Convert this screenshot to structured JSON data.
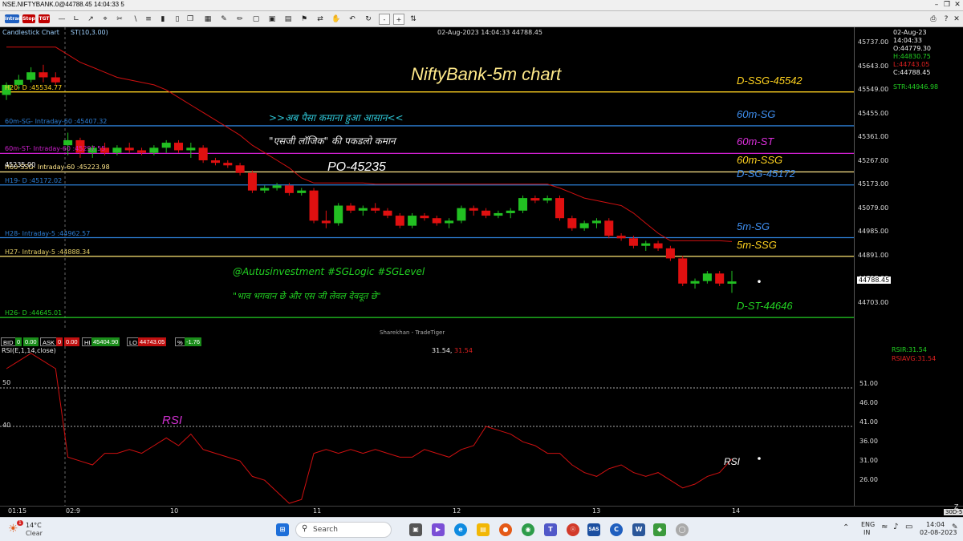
{
  "window": {
    "title": "NSE.NIFTYBANK.0@44788.45 14:04:33 5"
  },
  "toolbar": {
    "intraday_label": "Intraday",
    "stop_label": "Stop",
    "tgt_label": "TGT",
    "zoom_minus": "-",
    "zoom_plus": "+"
  },
  "chart": {
    "type_label": "Candlestick Chart",
    "indicator_label": "ST(10,3.00)",
    "header_time": "02-Aug-2023 14:04:33 44788.45",
    "title_annotation": "NiftyBank-5m chart",
    "hindi_line1": ">>अब पैसा कमाना हुआ आसान<<",
    "hindi_line2": "\"एसजी लॉजिक\" की पकडलो कमान",
    "po_label": "PO-45235",
    "handle_line": "@Autusinvestment  #SGLogic  #SGLevel",
    "hindi_line3": "\"भाव भगवान छे और एस जी लेवल देवदूत छे\"",
    "watermark": "Sharekhan - TradeTiger",
    "levels": [
      {
        "left_label": "H20- D :45534.77",
        "right_label": "D-SSG-45542",
        "price": 45542,
        "color": "#ffd21f",
        "right_color": "#ffd21f"
      },
      {
        "left_label": "60m-SG- Intraday-60 :45407.32",
        "right_label": "60m-SG",
        "price": 45407.32,
        "color": "#2d7fd6",
        "right_color": "#3f8ff0"
      },
      {
        "left_label": "60m-ST- Intraday-60 :45297.55",
        "right_label": "60m-ST",
        "price": 45297.55,
        "color": "#d020d0",
        "right_color": "#e030e0"
      },
      {
        "left_label": "H60-SSG- Intraday-60 :45223.98",
        "right_label": "60m-SSG",
        "price": 45223.98,
        "color": "#ffe68a",
        "right_color": "#ffd21f"
      },
      {
        "left_label": "45235.00",
        "right_label": "",
        "price": 45235,
        "color": "#ffffff",
        "right_color": "#ffffff"
      },
      {
        "left_label": "H19- D :45172.02",
        "right_label": "D-SG-45172",
        "price": 45172.02,
        "color": "#2d7fd6",
        "right_color": "#3f8ff0"
      },
      {
        "left_label": "H28- Intraday-5 :44962.57",
        "right_label": "5m-SG",
        "price": 44962.57,
        "color": "#2d7fd6",
        "right_color": "#3f8ff0"
      },
      {
        "left_label": "H27- Intraday-5 :44888.34",
        "right_label": "5m-SSG",
        "price": 44888.34,
        "color": "#e8d36a",
        "right_color": "#ffd21f"
      },
      {
        "left_label": "H26- D :44645.01",
        "right_label": "D-ST-44646",
        "price": 44645.01,
        "color": "#22d022",
        "right_color": "#22d022"
      }
    ],
    "price_axis": [
      "45737.00",
      "45643.00",
      "45549.00",
      "45455.00",
      "45361.00",
      "45267.00",
      "45173.00",
      "45079.00",
      "44985.00",
      "44891.00",
      "44797.00",
      "44703.00"
    ],
    "current_price_tag": "44788.45",
    "ohlc_panel": {
      "date": "02-Aug-23",
      "time": "14:04:33",
      "open": "O:44779.30",
      "high": "H:44830.75",
      "low": "L:44743.05",
      "close": "C:44788.45",
      "str": "STR:44946.98"
    }
  },
  "quote_bar": {
    "bid_label": "BID",
    "bid_qty": "0",
    "bid_val": "0.00",
    "ask_label": "ASK",
    "ask_qty": "0",
    "ask_val": "0.00",
    "hi_label": "HI",
    "hi_val": "45404.90",
    "lo_label": "LO",
    "lo_val": "44743.05",
    "pct_label": "%",
    "pct_val": "-1.76"
  },
  "rsi": {
    "label": "RSI(E,1,14,close)",
    "value_text": "31.54, ",
    "value_text2": "31.54",
    "annotation_top": "RSI",
    "annotation_bottom": "RSI",
    "level_50": "50",
    "level_40": "40",
    "axis": [
      "51.00",
      "46.00",
      "41.00",
      "36.00",
      "31.00",
      "26.00"
    ],
    "rsir": "RSIR:31.54",
    "rsiavg": "RSIAVG:31.54"
  },
  "timebar": {
    "labels": [
      "01:15",
      "02:9",
      "10",
      "11",
      "12",
      "13",
      "14"
    ],
    "right": "30D-5",
    "z": "Z"
  },
  "taskbar": {
    "weather_temp": "14°C",
    "weather_desc": "Clear",
    "badge": "1",
    "search_placeholder": "Search",
    "lang1": "ENG",
    "lang2": "IN",
    "time": "14:04",
    "date": "02-08-2023"
  },
  "chart_data": {
    "type": "candlestick",
    "ylim": [
      44620,
      45780
    ],
    "candles": [
      [
        45530,
        45580,
        45510,
        45570
      ],
      [
        45570,
        45610,
        45550,
        45590
      ],
      [
        45590,
        45640,
        45580,
        45620
      ],
      [
        45620,
        45650,
        45580,
        45600
      ],
      [
        45600,
        45620,
        45570,
        45580
      ],
      [
        45330,
        45380,
        45290,
        45350
      ],
      [
        45350,
        45360,
        45280,
        45300
      ],
      [
        45300,
        45330,
        45280,
        45320
      ],
      [
        45320,
        45340,
        45290,
        45300
      ],
      [
        45300,
        45330,
        45290,
        45320
      ],
      [
        45320,
        45340,
        45300,
        45310
      ],
      [
        45310,
        45320,
        45290,
        45300
      ],
      [
        45300,
        45330,
        45290,
        45320
      ],
      [
        45320,
        45350,
        45300,
        45340
      ],
      [
        45340,
        45350,
        45300,
        45310
      ],
      [
        45310,
        45340,
        45280,
        45320
      ],
      [
        45320,
        45330,
        45260,
        45270
      ],
      [
        45270,
        45280,
        45250,
        45260
      ],
      [
        45260,
        45270,
        45240,
        45250
      ],
      [
        45250,
        45260,
        45210,
        45220
      ],
      [
        45220,
        45230,
        45140,
        45150
      ],
      [
        45150,
        45170,
        45140,
        45160
      ],
      [
        45160,
        45180,
        45150,
        45170
      ],
      [
        45170,
        45180,
        45130,
        45140
      ],
      [
        45140,
        45160,
        45130,
        45150
      ],
      [
        45150,
        45160,
        45020,
        45030
      ],
      [
        45030,
        45070,
        45000,
        45020
      ],
      [
        45020,
        45100,
        45010,
        45090
      ],
      [
        45090,
        45100,
        45060,
        45070
      ],
      [
        45070,
        45090,
        45050,
        45080
      ],
      [
        45080,
        45100,
        45060,
        45070
      ],
      [
        45070,
        45080,
        45040,
        45050
      ],
      [
        45050,
        45060,
        45000,
        45010
      ],
      [
        45010,
        45060,
        45000,
        45050
      ],
      [
        45050,
        45060,
        45030,
        45040
      ],
      [
        45040,
        45050,
        45010,
        45020
      ],
      [
        45020,
        45040,
        45000,
        45030
      ],
      [
        45030,
        45090,
        45020,
        45080
      ],
      [
        45080,
        45090,
        45050,
        45070
      ],
      [
        45070,
        45080,
        45040,
        45050
      ],
      [
        45050,
        45070,
        45040,
        45060
      ],
      [
        45060,
        45080,
        45040,
        45070
      ],
      [
        45070,
        45130,
        45060,
        45120
      ],
      [
        45120,
        45130,
        45100,
        45110
      ],
      [
        45110,
        45130,
        45100,
        45120
      ],
      [
        45120,
        45130,
        45030,
        45040
      ],
      [
        45040,
        45050,
        44990,
        45000
      ],
      [
        45000,
        45030,
        44990,
        45020
      ],
      [
        45020,
        45040,
        45000,
        45030
      ],
      [
        45030,
        45040,
        44960,
        44970
      ],
      [
        44970,
        44980,
        44950,
        44960
      ],
      [
        44960,
        44970,
        44920,
        44930
      ],
      [
        44930,
        44950,
        44910,
        44940
      ],
      [
        44940,
        44950,
        44910,
        44920
      ],
      [
        44920,
        44930,
        44870,
        44880
      ],
      [
        44880,
        44890,
        44770,
        44780
      ],
      [
        44780,
        44800,
        44760,
        44790
      ],
      [
        44790,
        44830,
        44780,
        44820
      ],
      [
        44820,
        44830,
        44770,
        44780
      ],
      [
        44779.3,
        44830.75,
        44743.05,
        44788.45
      ]
    ],
    "supertrend": [
      45720,
      45720,
      45720,
      45720,
      45720,
      45690,
      45660,
      45640,
      45620,
      45600,
      45590,
      45580,
      45570,
      45550,
      45520,
      45490,
      45460,
      45430,
      45400,
      45370,
      45330,
      45300,
      45270,
      45240,
      45200,
      45180,
      45180,
      45180,
      45180,
      45180,
      45175,
      45175,
      45175,
      45175,
      45175,
      45175,
      45175,
      45175,
      45175,
      45175,
      45175,
      45175,
      45175,
      45175,
      45175,
      45160,
      45140,
      45120,
      45110,
      45100,
      45090,
      45060,
      45020,
      44980,
      44950,
      44950,
      44950,
      44950,
      44950,
      44947
    ],
    "rsi_values": [
      55,
      57,
      59,
      57,
      55,
      32,
      31,
      30,
      33,
      33,
      34,
      33,
      35,
      37,
      35,
      38,
      34,
      33,
      32,
      31,
      27,
      26,
      23,
      20,
      21,
      33,
      34,
      33,
      34,
      33,
      34,
      33,
      32,
      32,
      34,
      33,
      32,
      34,
      35,
      40,
      39,
      38,
      36,
      35,
      33,
      33,
      30,
      28,
      27,
      29,
      30,
      28,
      27,
      28,
      26,
      24,
      25,
      27,
      28,
      31.54
    ]
  }
}
